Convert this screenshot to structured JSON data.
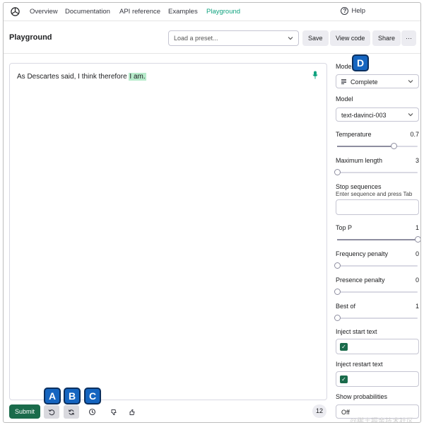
{
  "nav": {
    "items": [
      "Overview",
      "Documentation",
      "API reference",
      "Examples",
      "Playground"
    ],
    "active": "Playground",
    "help": "Help"
  },
  "header": {
    "title": "Playground",
    "preset_placeholder": "Load a preset...",
    "save": "Save",
    "view_code": "View code",
    "share": "Share",
    "more": "···"
  },
  "editor": {
    "text_plain": "As Descartes said, I think therefore",
    "text_completion": "I am."
  },
  "toolbar": {
    "submit": "Submit",
    "token_count": "12"
  },
  "badges": [
    "A",
    "B",
    "C",
    "D"
  ],
  "panel": {
    "mode_label": "Mode",
    "mode_value": "Complete",
    "model_label": "Model",
    "model_value": "text-davinci-003",
    "temperature_label": "Temperature",
    "temperature_value": "0.7",
    "temperature_fraction": 0.7,
    "max_length_label": "Maximum length",
    "max_length_value": "3",
    "max_length_fraction": 0.0,
    "stop_label": "Stop sequences",
    "stop_hint": "Enter sequence and press Tab",
    "top_p_label": "Top P",
    "top_p_value": "1",
    "top_p_fraction": 1.0,
    "freq_label": "Frequency penalty",
    "freq_value": "0",
    "freq_fraction": 0.0,
    "presence_label": "Presence penalty",
    "presence_value": "0",
    "presence_fraction": 0.0,
    "best_of_label": "Best of",
    "best_of_value": "1",
    "best_of_fraction": 0.0,
    "inject_start_label": "Inject start text",
    "inject_restart_label": "Inject restart text",
    "show_prob_label": "Show probabilities",
    "show_prob_value": "Off"
  },
  "watermark": "@稀土掘金技术社区",
  "colors": {
    "accent": "#10a37f",
    "submit": "#1a6b4b",
    "badge": "#1565c0",
    "highlight": "#b7ebcb"
  }
}
